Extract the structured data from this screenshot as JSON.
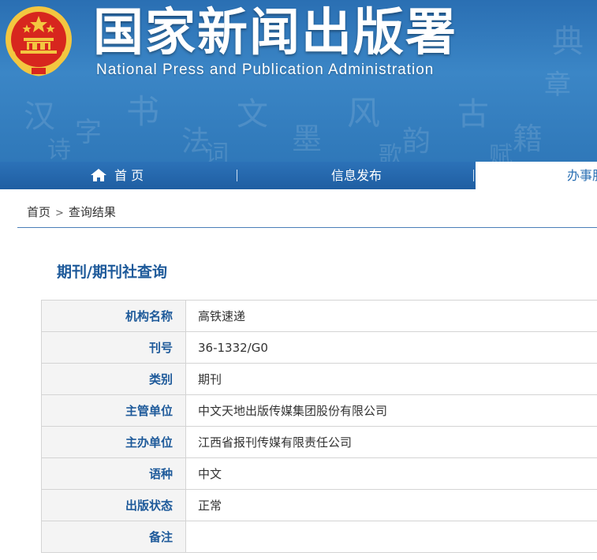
{
  "header": {
    "title_cn": "国家新闻出版署",
    "title_en": "National  Press and Publication Administration",
    "emblem_icon": "national-emblem-icon"
  },
  "nav": {
    "home": "首 页",
    "home_icon": "home-icon",
    "info": "信息发布",
    "services": "办事服务"
  },
  "breadcrumb": {
    "home": "首页",
    "separator": ">",
    "current": "查询结果"
  },
  "section": {
    "title": "期刊/期刊社查询"
  },
  "table": {
    "rows": [
      {
        "label": "机构名称",
        "value": "高铁速递"
      },
      {
        "label": "刊号",
        "value": "36-1332/G0"
      },
      {
        "label": "类别",
        "value": "期刊"
      },
      {
        "label": "主管单位",
        "value": "中文天地出版传媒集团股份有限公司"
      },
      {
        "label": "主办单位",
        "value": "江西省报刊传媒有限责任公司"
      },
      {
        "label": "语种",
        "value": "中文"
      },
      {
        "label": "出版状态",
        "value": "正常"
      },
      {
        "label": "备注",
        "value": ""
      }
    ]
  },
  "colors": {
    "header_blue": "#2a6fb3",
    "nav_blue": "#1f5ea2",
    "label_blue": "#1e5a9a",
    "emblem_red": "#d7261e",
    "emblem_gold": "#f3c640"
  }
}
